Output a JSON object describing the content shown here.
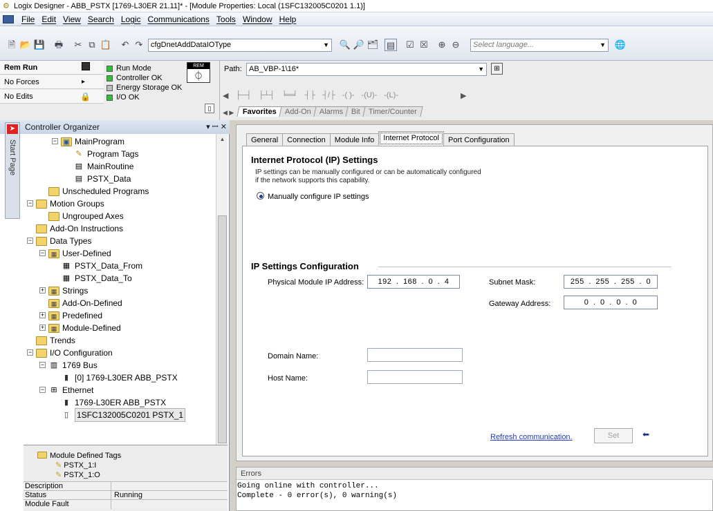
{
  "window": {
    "title": "Logix Designer - ABB_PSTX [1769-L30ER 21.11]* - [Module Properties: Local (1SFC132005C0201 1.1)]"
  },
  "menu": [
    {
      "label": "File"
    },
    {
      "label": "Edit"
    },
    {
      "label": "View"
    },
    {
      "label": "Search"
    },
    {
      "label": "Logic"
    },
    {
      "label": "Communications"
    },
    {
      "label": "Tools"
    },
    {
      "label": "Window"
    },
    {
      "label": "Help"
    }
  ],
  "toolbar": {
    "type_combo": "cfgDnetAddDataIOType",
    "language_placeholder": "Select language..."
  },
  "status": {
    "mode": "Rem Run",
    "forces": "No Forces",
    "edits": "No Edits",
    "indicators": [
      {
        "label": "Run Mode",
        "led": "green"
      },
      {
        "label": "Controller OK",
        "led": "green"
      },
      {
        "label": "Energy Storage OK",
        "led": "gray"
      },
      {
        "label": "I/O OK",
        "led": "green"
      }
    ],
    "rem_badge": "REM"
  },
  "path": {
    "label": "Path:",
    "value": "AB_VBP-1\\16*"
  },
  "ladder_tabs": [
    "Favorites",
    "Add-On",
    "Alarms",
    "Bit",
    "Timer/Counter"
  ],
  "organizer": {
    "title": "Controller Organizer",
    "start_page": "Start Page",
    "tree": [
      {
        "label": "MainProgram",
        "depth": 2,
        "icon": "program"
      },
      {
        "label": "Program Tags",
        "depth": 3,
        "icon": "tags"
      },
      {
        "label": "MainRoutine",
        "depth": 3,
        "icon": "routine"
      },
      {
        "label": "PSTX_Data",
        "depth": 3,
        "icon": "routine"
      },
      {
        "label": "Unscheduled Programs",
        "depth": 1,
        "icon": "folder"
      },
      {
        "label": "Motion Groups",
        "depth": 0,
        "icon": "folder"
      },
      {
        "label": "Ungrouped Axes",
        "depth": 1,
        "icon": "folder"
      },
      {
        "label": "Add-On Instructions",
        "depth": 0,
        "icon": "folder"
      },
      {
        "label": "Data Types",
        "depth": 0,
        "icon": "folder"
      },
      {
        "label": "User-Defined",
        "depth": 1,
        "icon": "datatype"
      },
      {
        "label": "PSTX_Data_From",
        "depth": 2,
        "icon": "struct"
      },
      {
        "label": "PSTX_Data_To",
        "depth": 2,
        "icon": "struct"
      },
      {
        "label": "Strings",
        "depth": 1,
        "icon": "datatype"
      },
      {
        "label": "Add-On-Defined",
        "depth": 1,
        "icon": "datatype"
      },
      {
        "label": "Predefined",
        "depth": 1,
        "icon": "datatype"
      },
      {
        "label": "Module-Defined",
        "depth": 1,
        "icon": "datatype"
      },
      {
        "label": "Trends",
        "depth": 0,
        "icon": "folder"
      },
      {
        "label": "I/O Configuration",
        "depth": 0,
        "icon": "folder"
      },
      {
        "label": "1769 Bus",
        "depth": 1,
        "icon": "bus"
      },
      {
        "label": "[0] 1769-L30ER ABB_PSTX",
        "depth": 2,
        "icon": "module"
      },
      {
        "label": "Ethernet",
        "depth": 1,
        "icon": "ethernet"
      },
      {
        "label": "1769-L30ER ABB_PSTX",
        "depth": 2,
        "icon": "module"
      },
      {
        "label": "1SFC132005C0201 PSTX_1",
        "depth": 2,
        "icon": "device"
      }
    ],
    "mdt": {
      "folder": "Module Defined Tags",
      "tags": [
        "PSTX_1:I",
        "PSTX_1:O"
      ],
      "grid": [
        {
          "key": "Description",
          "value": ""
        },
        {
          "key": "Status",
          "value": "Running"
        },
        {
          "key": "Module Fault",
          "value": ""
        }
      ]
    }
  },
  "props": {
    "tabs": [
      "General",
      "Connection",
      "Module Info",
      "Internet Protocol",
      "Port Configuration"
    ],
    "active_tab": "Internet Protocol",
    "ip_title": "Internet Protocol (IP) Settings",
    "ip_desc_1": "IP settings can be manually configured or can be automatically configured",
    "ip_desc_2": "if the network supports this capability.",
    "radio_label": "Manually configure IP settings",
    "cfg_title": "IP Settings Configuration",
    "phys_label": "Physical Module IP Address:",
    "phys_ip": "192 . 168 . 0 . 4",
    "subnet_label": "Subnet Mask:",
    "subnet_ip": "255 . 255 . 255 . 0",
    "gateway_label": "Gateway Address:",
    "gateway_ip": "0 . 0 . 0 . 0",
    "domain_label": "Domain Name:",
    "domain_value": "",
    "host_label": "Host Name:",
    "host_value": "",
    "refresh_link": "Refresh communication.",
    "set_button": "Set"
  },
  "errors": {
    "title": "Errors",
    "lines": [
      "Going online with controller...",
      "Complete - 0 error(s), 0 warning(s)"
    ]
  }
}
